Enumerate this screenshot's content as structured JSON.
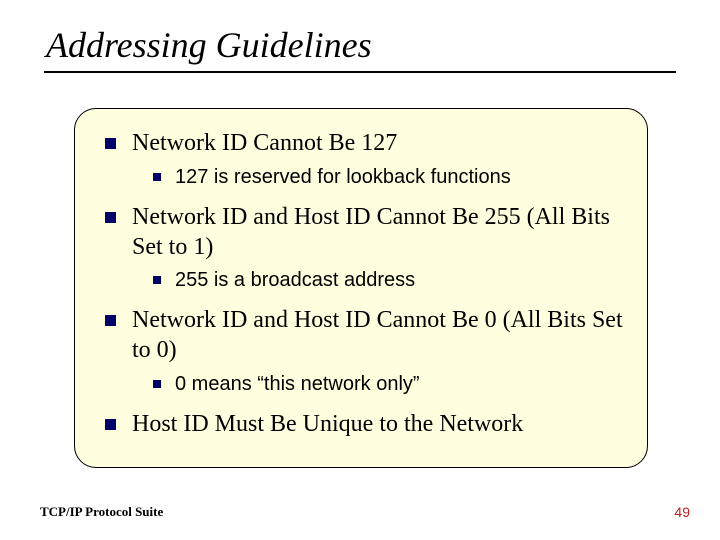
{
  "title": "Addressing Guidelines",
  "bullets": {
    "b1": "Network ID Cannot Be 127",
    "b1_1": "127 is reserved for lookback functions",
    "b2": "Network ID and Host ID Cannot Be 255 (All Bits Set to 1)",
    "b2_1": "255 is a broadcast address",
    "b3": "Network ID and Host ID Cannot Be 0 (All Bits Set to 0)",
    "b3_1": "0 means “this network only”",
    "b4": "Host ID Must Be Unique to the Network"
  },
  "footer": {
    "left": "TCP/IP Protocol Suite",
    "right": "49"
  }
}
